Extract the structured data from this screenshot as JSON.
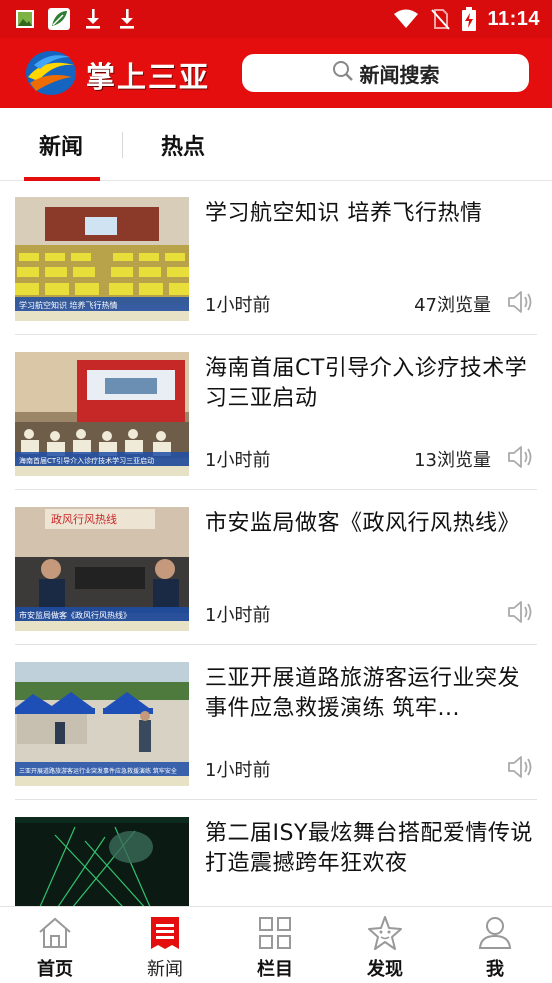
{
  "status_bar": {
    "time": "11:14",
    "left_icons": [
      "gallery-icon",
      "app-leaf-icon",
      "download-icon",
      "download-icon"
    ],
    "right_icons": [
      "wifi-icon",
      "no-sim-icon",
      "battery-charging-icon"
    ]
  },
  "header": {
    "app_title": "掌上三亚",
    "search_placeholder": "新闻搜索",
    "accent_color": "#e40e0e"
  },
  "tabs": [
    {
      "label": "新闻",
      "active": true
    },
    {
      "label": "热点",
      "active": false
    }
  ],
  "news": [
    {
      "title": "学习航空知识 培养飞行热情",
      "time": "1小时前",
      "views": "47浏览量",
      "thumb_caption": "学习航空知识 培养飞行热情"
    },
    {
      "title": "海南首届CT引导介入诊疗技术学习三亚启动",
      "time": "1小时前",
      "views": "13浏览量",
      "thumb_caption": "海南首届CT引导介入诊疗技术学习三亚启动"
    },
    {
      "title": "市安监局做客《政风行风热线》",
      "time": "1小时前",
      "views": "",
      "thumb_caption": "市安监局做客《政风行风热线》"
    },
    {
      "title": "三亚开展道路旅游客运行业突发事件应急救援演练 筑牢...",
      "time": "1小时前",
      "views": "",
      "thumb_caption": "三亚开展道路旅游客运行业突发事件应急救援演练 筑牢安全"
    },
    {
      "title": "第二届ISY最炫舞台搭配爱情传说 打造震撼跨年狂欢夜",
      "time": "",
      "views": "",
      "thumb_caption": ""
    }
  ],
  "bottom_nav": [
    {
      "label": "首页",
      "icon": "home-icon",
      "active": false
    },
    {
      "label": "新闻",
      "icon": "news-icon",
      "active": true
    },
    {
      "label": "栏目",
      "icon": "grid-icon",
      "active": false
    },
    {
      "label": "发现",
      "icon": "star-icon",
      "active": false
    },
    {
      "label": "我",
      "icon": "user-icon",
      "active": false
    }
  ]
}
